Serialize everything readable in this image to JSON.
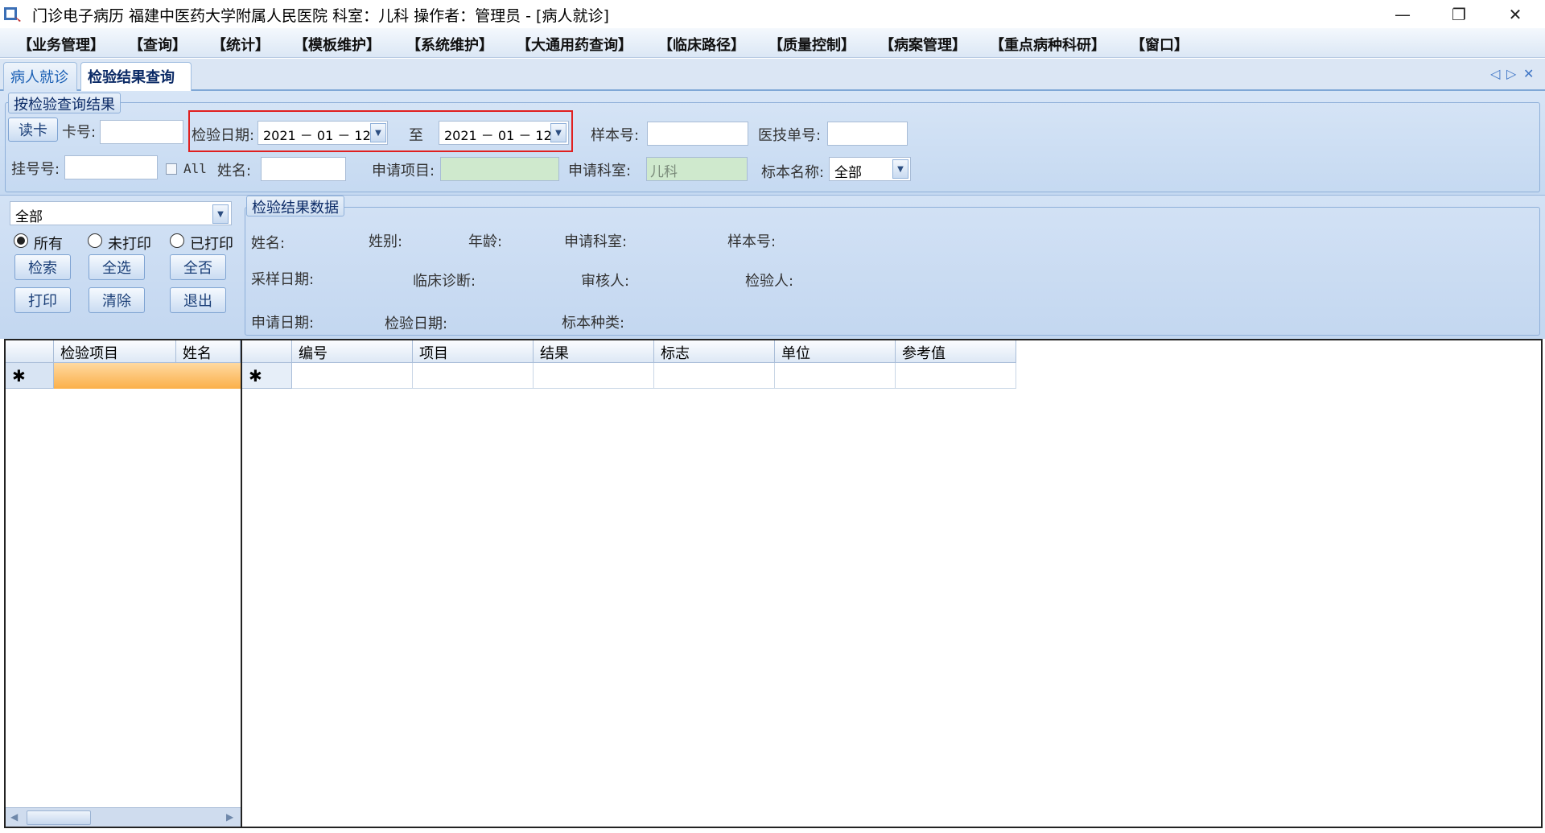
{
  "window": {
    "title": "门诊电子病历  福建中医药大学附属人民医院  科室：儿科  操作者：管理员 - [病人就诊]"
  },
  "menu": [
    "【业务管理】",
    "【查询】",
    "【统计】",
    "【模板维护】",
    "【系统维护】",
    "【大通用药查询】",
    "【临床路径】",
    "【质量控制】",
    "【病案管理】",
    "【重点病种科研】",
    "【窗口】"
  ],
  "tabs": {
    "patient": "病人就诊",
    "lab": "检验结果查询"
  },
  "search": {
    "group_title": "按检验查询结果",
    "read_card": "读卡",
    "card_no": "卡号:",
    "test_date": "检验日期:",
    "date_from": "2021 － 01 － 12",
    "to": "至",
    "date_to": "2021 － 01 － 12",
    "sample_no": "样本号:",
    "tech_no": "医技单号:",
    "reg_no": "挂号号:",
    "all": "All",
    "name": "姓名:",
    "apply_item": "申请项目:",
    "apply_dept": "申请科室:",
    "apply_dept_value": "儿科",
    "specimen_name": "标本名称:",
    "specimen_value": "全部"
  },
  "left": {
    "filter_value": "全部",
    "radio_all": "所有",
    "radio_unprinted": "未打印",
    "radio_printed": "已打印",
    "btn_search": "检索",
    "btn_select_all": "全选",
    "btn_select_none": "全否",
    "btn_print": "打印",
    "btn_clear": "清除",
    "btn_exit": "退出"
  },
  "info": {
    "group_title": "检验结果数据",
    "name": "姓名:",
    "sex": "姓别:",
    "age": "年龄:",
    "apply_dept": "申请科室:",
    "sample_no": "样本号:",
    "sample_date": "采样日期:",
    "diagnosis": "临床诊断:",
    "reviewer": "审核人:",
    "tester": "检验人:",
    "apply_date": "申请日期:",
    "test_date": "检验日期:",
    "specimen_type": "标本种类:"
  },
  "left_grid": {
    "columns": [
      "检验项目",
      "姓名"
    ],
    "new_row_marker": "✱"
  },
  "result_grid": {
    "columns": [
      "编号",
      "项目",
      "结果",
      "标志",
      "单位",
      "参考值"
    ],
    "new_row_marker": "✱"
  }
}
